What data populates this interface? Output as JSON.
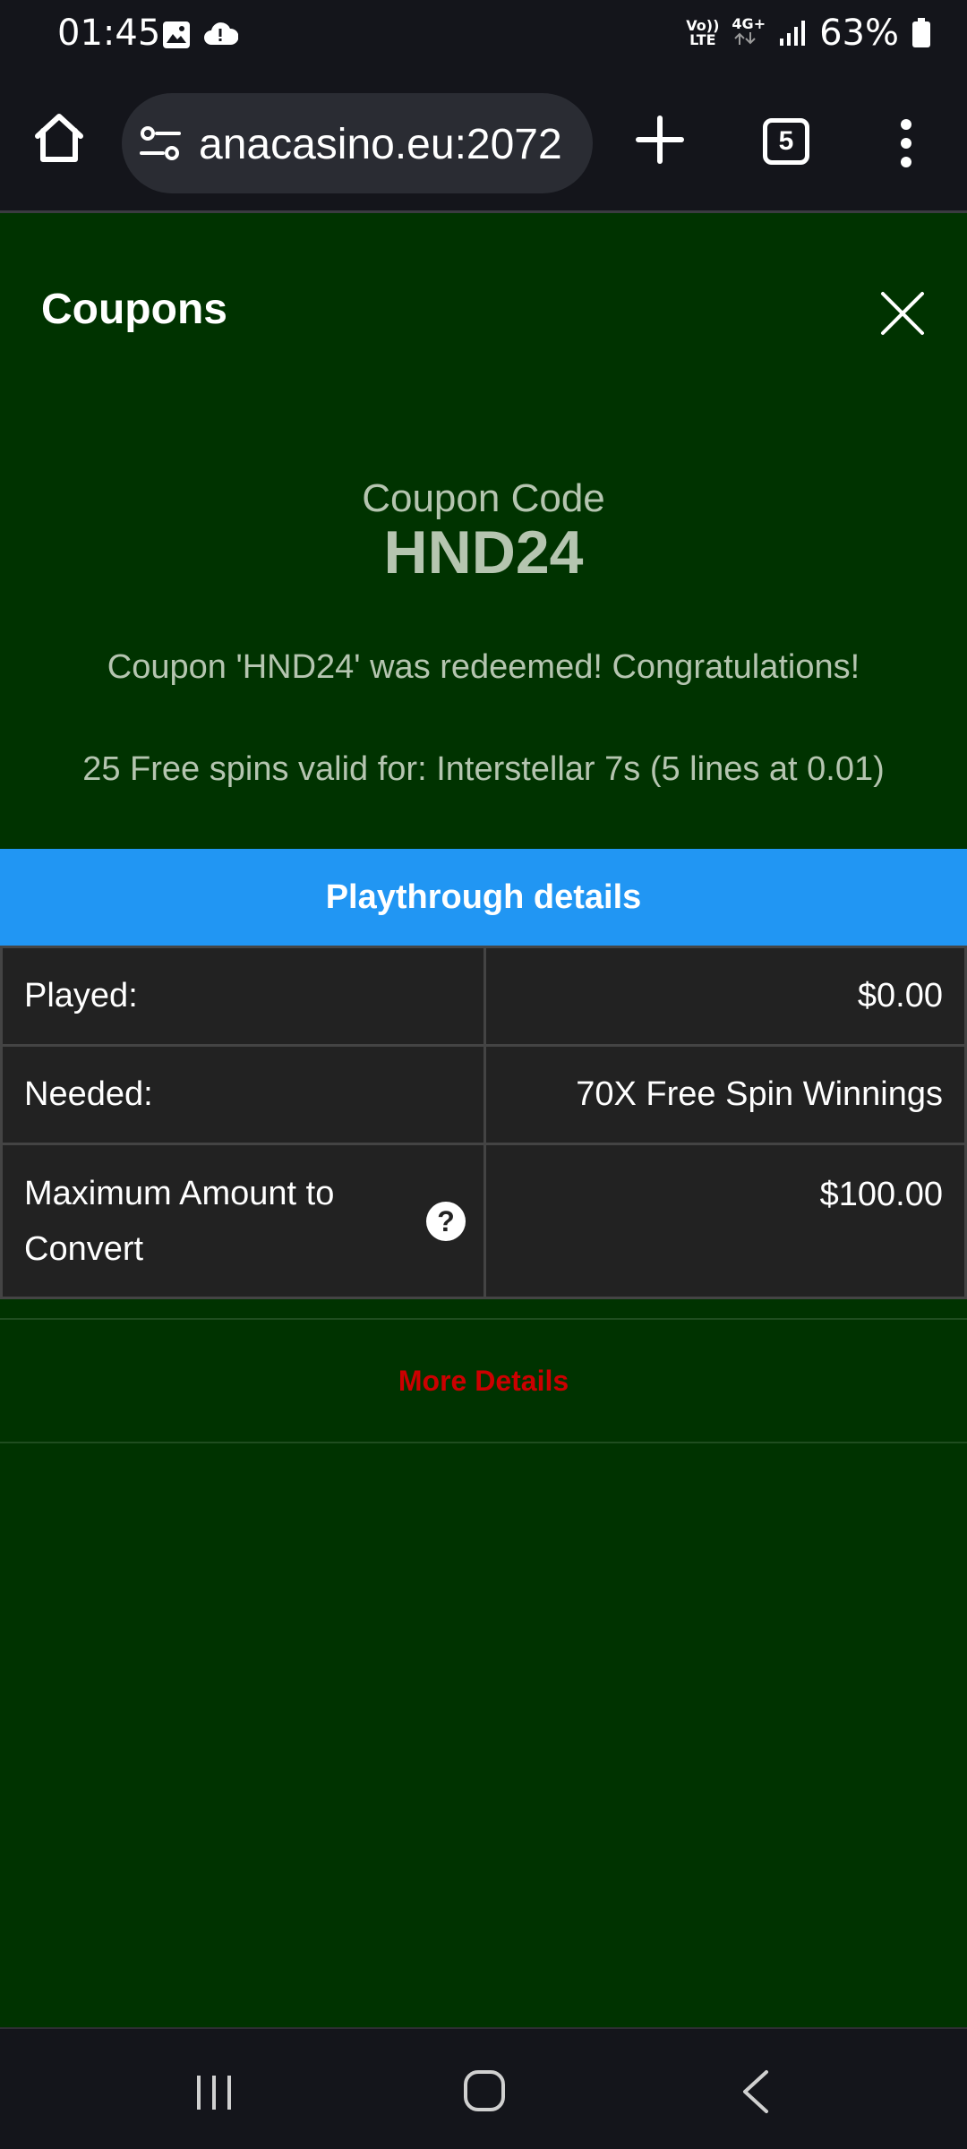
{
  "status_bar": {
    "time": "01:45",
    "icons": [
      "image-icon",
      "cloud-alert-icon"
    ],
    "network_top": "Vo))",
    "network_bottom": "LTE",
    "data_type": "4G+",
    "battery": "63%"
  },
  "browser": {
    "url": "anacasino.eu:2072",
    "tab_count": "5"
  },
  "modal": {
    "title": "Coupons",
    "coupon_label": "Coupon Code",
    "coupon_code": "HND24",
    "redeemed_message": "Coupon 'HND24' was redeemed! Congratulations!",
    "spins_message": "25 Free spins valid for: Interstellar 7s (5 lines at 0.01)"
  },
  "playthrough": {
    "header": "Playthrough details",
    "rows": [
      {
        "label": "Played:",
        "value": "$0.00"
      },
      {
        "label": "Needed:",
        "value": "70X Free Spin Winnings"
      },
      {
        "label": "Maximum Amount to Convert",
        "value": "$100.00"
      }
    ],
    "help_symbol": "?"
  },
  "more_details": "More Details",
  "colors": {
    "background": "#003300",
    "header_blue": "#2196f3",
    "link_red": "#cc0000",
    "table_bg": "#222222"
  }
}
